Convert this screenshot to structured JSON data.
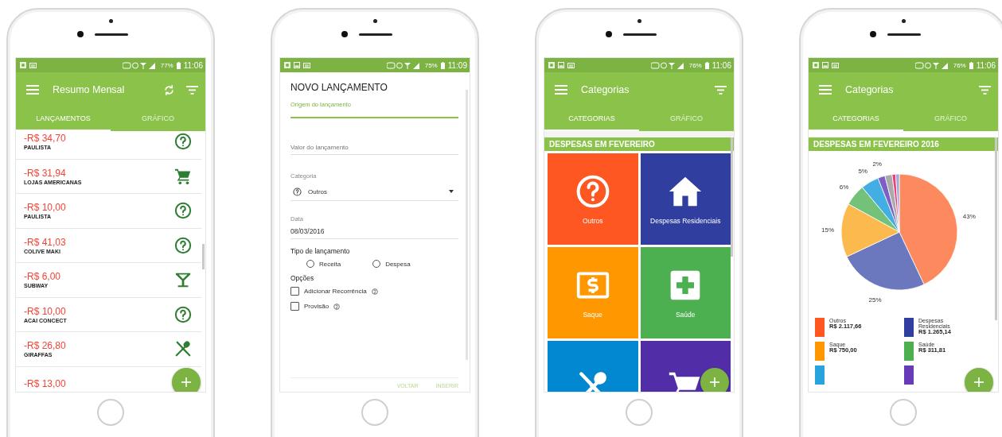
{
  "phones": [
    {
      "kind": "summary",
      "status_bar": {
        "notifications": [
          {
            "kind": "photo"
          },
          {
            "kind": "message"
          }
        ],
        "battery": "77%",
        "time": "11:06"
      },
      "toolbar": {
        "title": "Resumo Mensal",
        "actions": [
          {
            "kind": "sync"
          },
          {
            "kind": "filter"
          }
        ]
      },
      "tabs": [
        {
          "label": "LANÇAMENTOS",
          "selected": true
        },
        {
          "label": "GRÁFICO",
          "selected": false
        }
      ],
      "entries": [
        {
          "amount": "-R$ 34,70",
          "merchant": "PAULISTA",
          "kind": "question"
        },
        {
          "amount": "-R$ 31,94",
          "merchant": "LOJAS AMERICANAS",
          "kind": "cart"
        },
        {
          "amount": "-R$ 10,00",
          "merchant": "PAULISTA",
          "kind": "question"
        },
        {
          "amount": "-R$ 41,03",
          "merchant": "COLIVE MAKI",
          "kind": "question"
        },
        {
          "amount": "-R$ 6,00",
          "merchant": "SUBWAY",
          "kind": "cocktail"
        },
        {
          "amount": "-R$ 10,00",
          "merchant": "ACAI CONCECT",
          "kind": "question"
        },
        {
          "amount": "-R$ 26,80",
          "merchant": "GIRAFFAS",
          "kind": "cutlery"
        },
        {
          "amount": "-R$ 13,00"
        }
      ]
    },
    {
      "kind": "form",
      "status_bar": {
        "notifications": [
          {
            "kind": "photo"
          },
          {
            "kind": "gallery"
          },
          {
            "kind": "message"
          }
        ],
        "battery": "75%",
        "time": "11:09"
      },
      "title": "NOVO LANÇAMENTO",
      "fields": [
        {
          "kind": "text",
          "label": "Origem do lançamento",
          "focused": true
        },
        {
          "kind": "text",
          "placeholder": "Valor do lançamento",
          "focused": false
        },
        {
          "kind": "select",
          "label": "Categoria",
          "value": "Outros",
          "focused": false
        },
        {
          "kind": "text",
          "label": "Data",
          "value": "08/03/2016",
          "focused": false
        }
      ],
      "type_group": {
        "label": "Tipo de lançamento",
        "options": [
          {
            "label": "Receita",
            "selected": false
          },
          {
            "label": "Despesa",
            "selected": false
          }
        ]
      },
      "options_group": {
        "label": "Opções",
        "options": [
          {
            "label": "Adicionar Recorrência",
            "checked": false
          },
          {
            "label": "Provisão",
            "checked": false
          }
        ]
      },
      "buttons": [
        "VOLTAR",
        "INSERIR"
      ]
    },
    {
      "kind": "categories",
      "status_bar": {
        "notifications": [
          {
            "kind": "photo"
          },
          {
            "kind": "gallery"
          },
          {
            "kind": "message"
          }
        ],
        "battery": "76%",
        "time": "11:06"
      },
      "toolbar": {
        "title": "Categorias",
        "actions": [
          {
            "kind": "filter"
          }
        ]
      },
      "tabs": [
        {
          "label": "CATEGORIAS",
          "selected": true
        },
        {
          "label": "GRÁFICO",
          "selected": false
        }
      ],
      "section_title": "DESPESAS EM FEVEREIRO",
      "tiles": [
        {
          "label": "Outros",
          "kind": "question",
          "color": "#ff5722"
        },
        {
          "label": "Despesas Residenciais",
          "kind": "house",
          "color": "#303f9f"
        },
        {
          "label": "Saque",
          "kind": "cash",
          "color": "#ff9800"
        },
        {
          "label": "Saúde",
          "kind": "health",
          "color": "#4caf50"
        },
        {
          "kind": "cutlery",
          "color": "#0288d1"
        },
        {
          "kind": "cart",
          "color": "#512da8"
        }
      ]
    },
    {
      "kind": "chart",
      "status_bar": {
        "notifications": [
          {
            "kind": "photo"
          },
          {
            "kind": "gallery"
          },
          {
            "kind": "message"
          }
        ],
        "battery": "76%",
        "time": "11:06"
      },
      "toolbar": {
        "title": "Categorias",
        "actions": [
          {
            "kind": "filter"
          }
        ]
      },
      "tabs": [
        {
          "label": "CATEGORIAS",
          "selected": true
        },
        {
          "label": "GRÁFICO",
          "selected": false
        }
      ],
      "section_title": "DESPESAS EM FEVEREIRO 2016",
      "chart_data": {
        "type": "pie",
        "values": [
          43,
          25,
          15,
          6,
          5,
          2,
          2,
          1,
          1
        ],
        "colors": [
          "#fd8a5e",
          "#6c78bd",
          "#fbb94e",
          "#74c17a",
          "#42aee3",
          "#7e5fc6",
          "#aaaaaa",
          "#ec407a",
          "#9fa8da"
        ],
        "annotations": [
          {
            "text": "43%"
          },
          {
            "text": "25%"
          },
          {
            "text": "15%"
          },
          {
            "text": "6%"
          },
          {
            "text": "5%"
          },
          {
            "text": "2%"
          }
        ]
      },
      "legend": [
        {
          "name": "Outros",
          "amount": "R$ 2.117,66",
          "color": "#ff5722"
        },
        {
          "name": "Despesas Residenciais",
          "amount": "R$ 1.265,14",
          "color": "#303f9f"
        },
        {
          "name": "Saque",
          "amount": "R$ 750,00",
          "color": "#ff9800"
        },
        {
          "name": "Saúde",
          "amount": "R$ 311,81",
          "color": "#4caf50"
        },
        {
          "color": "#29a3dd"
        },
        {
          "color": "#673ab7"
        }
      ]
    }
  ]
}
